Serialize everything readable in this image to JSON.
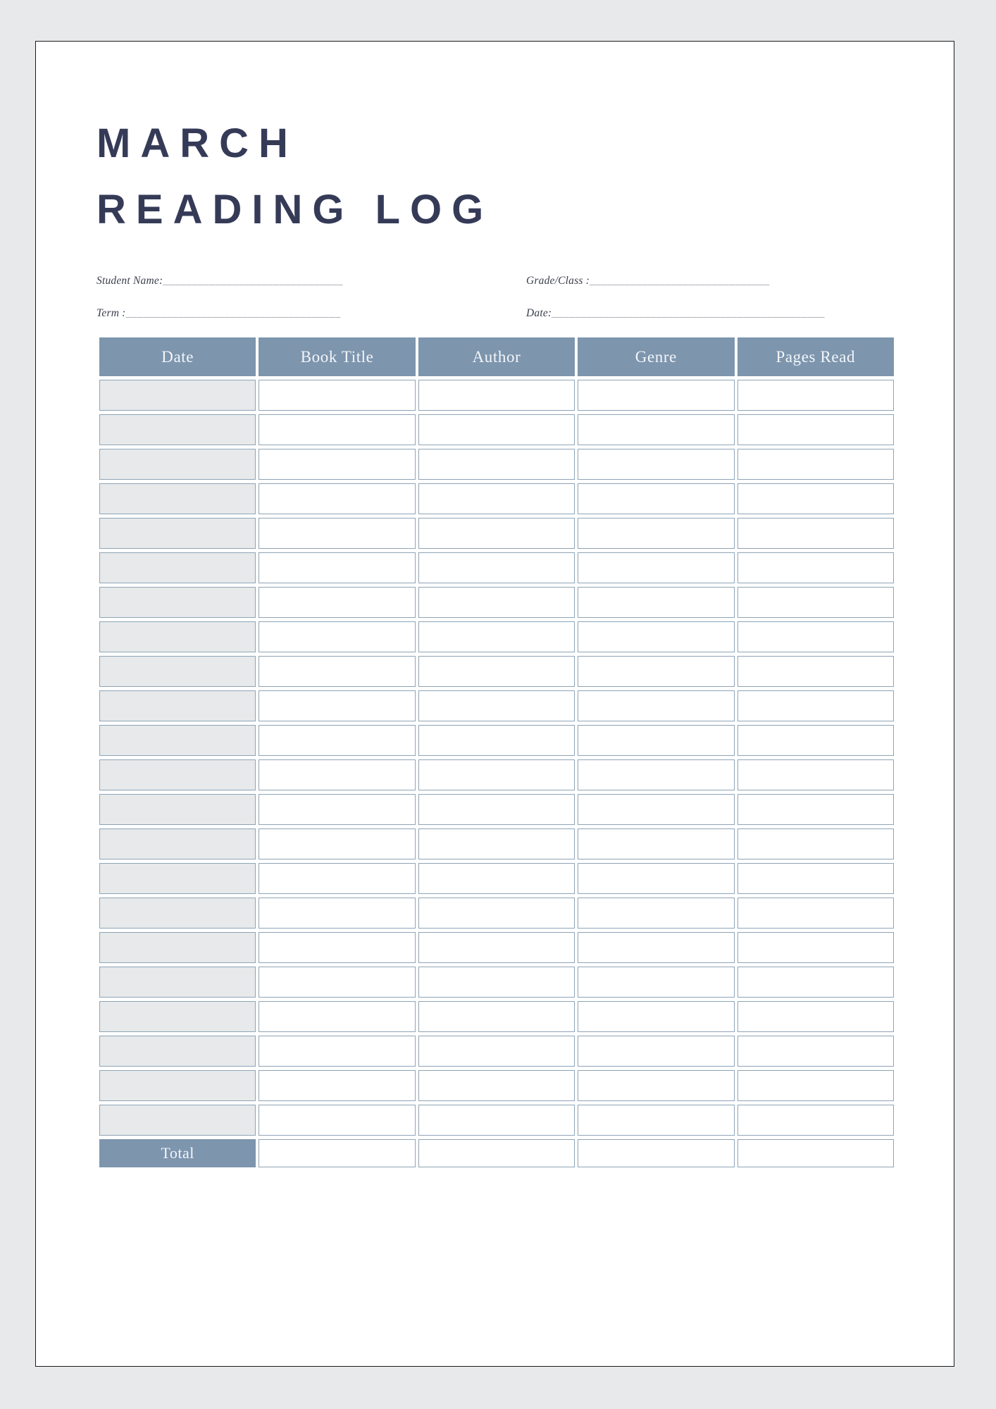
{
  "page": {
    "background_color": "#e8e9ea",
    "sheet_color": "#ffffff",
    "accent_color": "#7d95ad",
    "title_color": "#353b57",
    "date_cell_color": "#e7e9ea"
  },
  "title": {
    "line1": "MARCH",
    "line2": "READING LOG"
  },
  "meta": {
    "student_name_label": "Student Name:",
    "student_name_value": "_______________________________",
    "grade_class_label": "Grade/Class :",
    "grade_class_value": "_______________________________",
    "term_label": "Term :",
    "term_value": "_____________________________________",
    "date_label": "Date:",
    "date_value": "_______________________________________________"
  },
  "table": {
    "headers": [
      "Date",
      "Book Title",
      "Author",
      "Genre",
      "Pages Read"
    ],
    "row_count": 22,
    "rows": [
      [
        "",
        "",
        "",
        "",
        ""
      ],
      [
        "",
        "",
        "",
        "",
        ""
      ],
      [
        "",
        "",
        "",
        "",
        ""
      ],
      [
        "",
        "",
        "",
        "",
        ""
      ],
      [
        "",
        "",
        "",
        "",
        ""
      ],
      [
        "",
        "",
        "",
        "",
        ""
      ],
      [
        "",
        "",
        "",
        "",
        ""
      ],
      [
        "",
        "",
        "",
        "",
        ""
      ],
      [
        "",
        "",
        "",
        "",
        ""
      ],
      [
        "",
        "",
        "",
        "",
        ""
      ],
      [
        "",
        "",
        "",
        "",
        ""
      ],
      [
        "",
        "",
        "",
        "",
        ""
      ],
      [
        "",
        "",
        "",
        "",
        ""
      ],
      [
        "",
        "",
        "",
        "",
        ""
      ],
      [
        "",
        "",
        "",
        "",
        ""
      ],
      [
        "",
        "",
        "",
        "",
        ""
      ],
      [
        "",
        "",
        "",
        "",
        ""
      ],
      [
        "",
        "",
        "",
        "",
        ""
      ],
      [
        "",
        "",
        "",
        "",
        ""
      ],
      [
        "",
        "",
        "",
        "",
        ""
      ],
      [
        "",
        "",
        "",
        "",
        ""
      ],
      [
        "",
        "",
        "",
        "",
        ""
      ]
    ],
    "total_label": "Total",
    "total_values": [
      "",
      "",
      "",
      ""
    ]
  }
}
